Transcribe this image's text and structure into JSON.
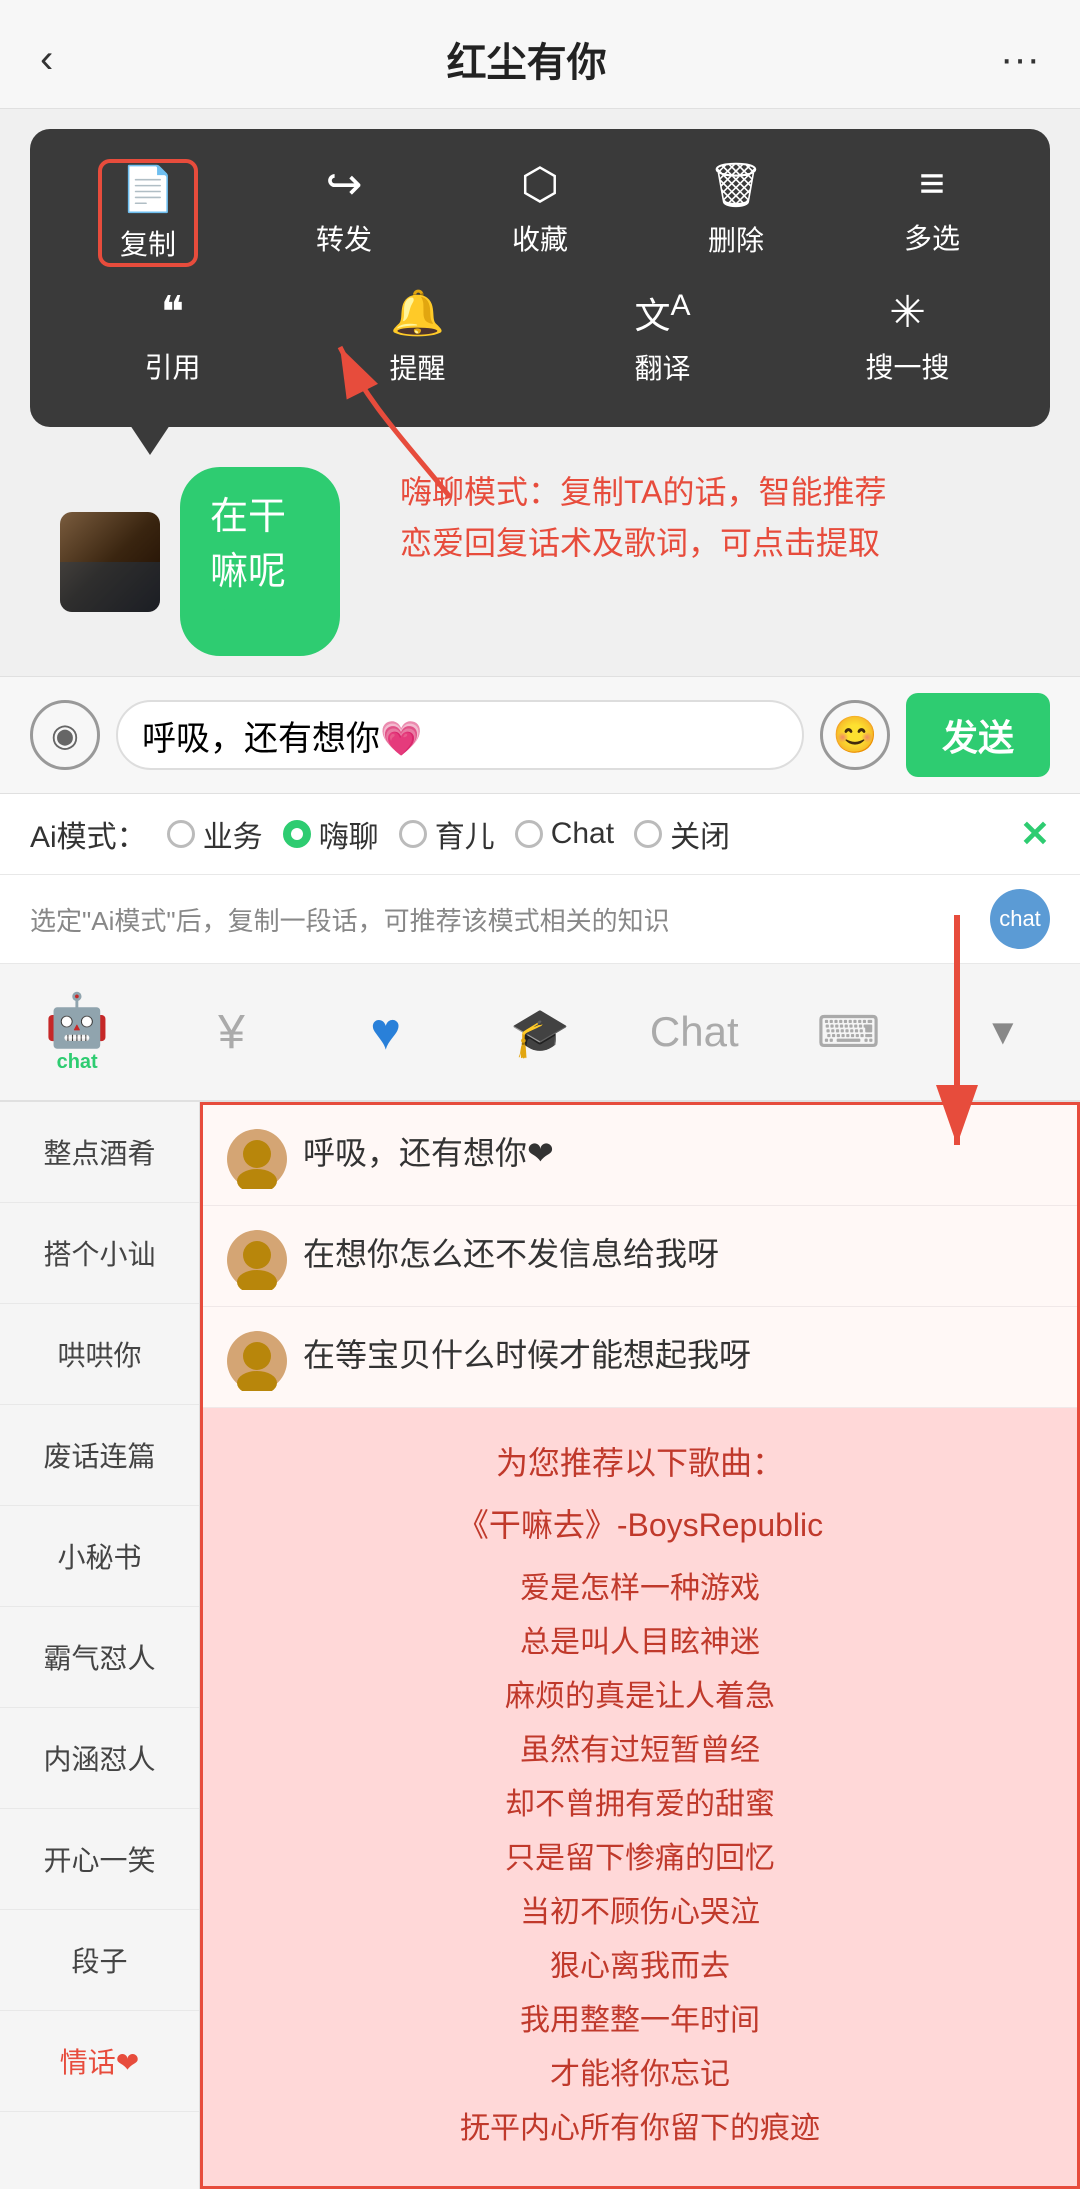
{
  "header": {
    "title": "红尘有你",
    "back_icon": "‹",
    "more_icon": "···"
  },
  "context_menu": {
    "items_row1": [
      {
        "label": "复制",
        "icon": "📄",
        "highlighted": true
      },
      {
        "label": "转发",
        "icon": "↪"
      },
      {
        "label": "收藏",
        "icon": "🎁"
      },
      {
        "label": "删除",
        "icon": "🗑"
      },
      {
        "label": "多选",
        "icon": "☰"
      }
    ],
    "items_row2": [
      {
        "label": "引用",
        "icon": "❝"
      },
      {
        "label": "提醒",
        "icon": "🔔"
      },
      {
        "label": "翻译",
        "icon": "文A"
      },
      {
        "label": "搜一搜",
        "icon": "✳"
      }
    ]
  },
  "chat": {
    "bubble_text": "在干嘛呢",
    "online_indicator": true
  },
  "annotation": {
    "text": "嗨聊模式：复制TA的话，智能推荐\n恋爱回复话术及歌词，可点击提取"
  },
  "input_area": {
    "voice_icon": "◉",
    "placeholder": "呼吸，还有想你💗",
    "emoji_icon": "😊",
    "send_label": "发送"
  },
  "ai_mode": {
    "label": "Ai模式：",
    "options": [
      {
        "label": "业务",
        "active": false
      },
      {
        "label": "嗨聊",
        "active": true
      },
      {
        "label": "育儿",
        "active": false
      },
      {
        "label": "Chat",
        "active": false
      },
      {
        "label": "关闭",
        "active": false
      }
    ],
    "close_icon": "✕"
  },
  "info_bar": {
    "text": "选定\"Ai模式\"后，复制一段话，可推荐该模式相关的知识",
    "chat_icon": "chat"
  },
  "toolbar": {
    "items": [
      {
        "icon": "🤖",
        "label": "chat",
        "active": true
      },
      {
        "icon": "¥",
        "label": "money",
        "active": false
      },
      {
        "icon": "♥",
        "label": "heart",
        "active": false
      },
      {
        "icon": "🎓",
        "label": "graduate",
        "active": false
      },
      {
        "icon": "Chat",
        "label": "chat-text",
        "active": false
      },
      {
        "icon": "⌨",
        "label": "keyboard",
        "active": false
      },
      {
        "icon": "▼",
        "label": "dropdown",
        "active": false
      }
    ]
  },
  "sidebar": {
    "items": [
      {
        "label": "整点酒肴"
      },
      {
        "label": "搭个小讪"
      },
      {
        "label": "哄哄你"
      },
      {
        "label": "废话连篇"
      },
      {
        "label": "小秘书"
      },
      {
        "label": "霸气怼人"
      },
      {
        "label": "内涵怼人"
      },
      {
        "label": "开心一笑"
      },
      {
        "label": "段子"
      },
      {
        "label": "情话❤"
      }
    ]
  },
  "responses": [
    {
      "text": "呼吸，还有想你❤"
    },
    {
      "text": "在想你怎么还不发信息给我呀"
    },
    {
      "text": "在等宝贝什么时候才能想起我呀"
    }
  ],
  "song_section": {
    "intro": "为您推荐以下歌曲：",
    "song_name": "《干嘛去》-BoysRepublic",
    "lyrics": [
      "爱是怎样一种游戏",
      "总是叫人目眩神迷",
      "麻烦的真是让人着急",
      "虽然有过短暂曾经",
      "却不曾拥有爱的甜蜜",
      "只是留下惨痛的回忆",
      "当初不顾伤心哭泣",
      "狠心离我而去",
      "我用整整一年时间",
      "才能将你忘记",
      "抚平内心所有你留下的痕迹"
    ]
  }
}
